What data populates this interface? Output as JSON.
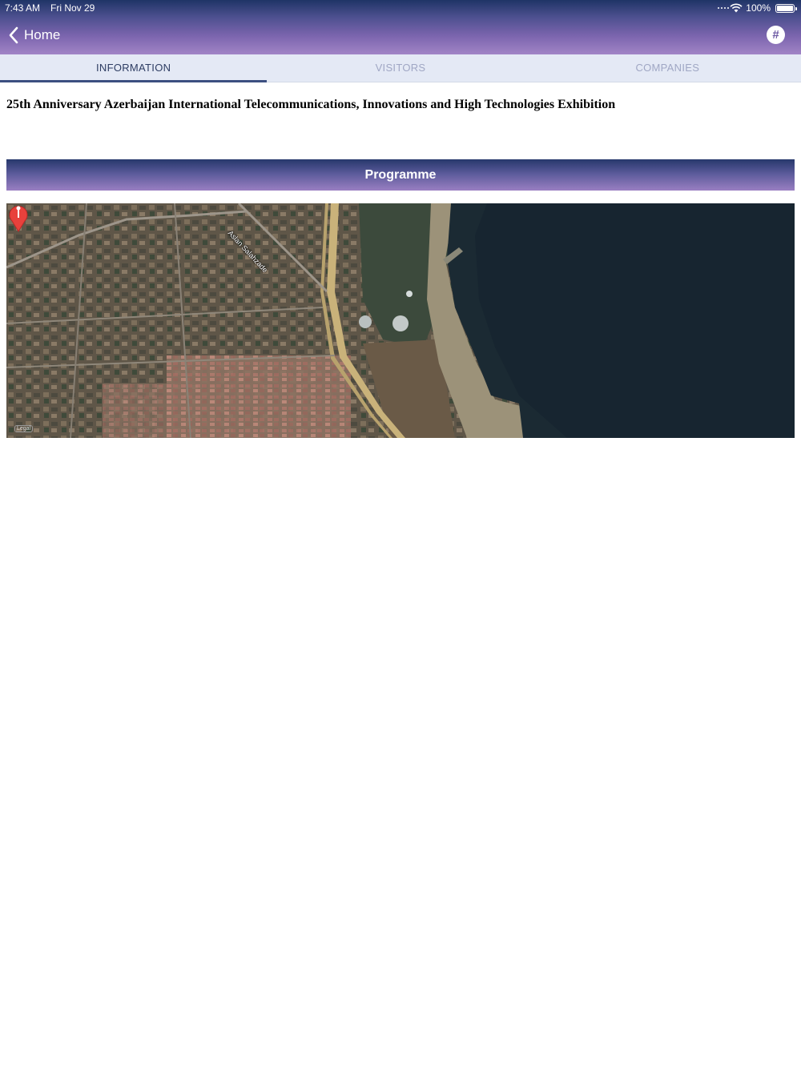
{
  "status_bar": {
    "time": "7:43 AM",
    "date": "Fri Nov 29",
    "battery_text": "100%",
    "battery_level": 1.0
  },
  "nav": {
    "back_label": "Home",
    "back_icon": "chevron-left-icon",
    "action_icon": "hashtag-icon",
    "action_symbol": "#"
  },
  "tabs": [
    {
      "label": "INFORMATION",
      "active": true
    },
    {
      "label": "VISITORS",
      "active": false
    },
    {
      "label": "COMPANIES",
      "active": false
    }
  ],
  "event": {
    "title": "25th Anniversary Azerbaijan International Telecommunications, Innovations and High Technologies Exhibition"
  },
  "programme_button": {
    "label": "Programme"
  },
  "map": {
    "street_label": "Aslan Salahzade",
    "legal_label": "Legal",
    "pin_icon": "map-pin-icon"
  },
  "colors": {
    "header_top": "#1f3466",
    "header_bottom": "#a184c6",
    "tab_bar": "#e4e9f5",
    "tab_active": "#2e3d63",
    "tab_inactive": "#a0a7c4",
    "pin": "#e8413c"
  }
}
